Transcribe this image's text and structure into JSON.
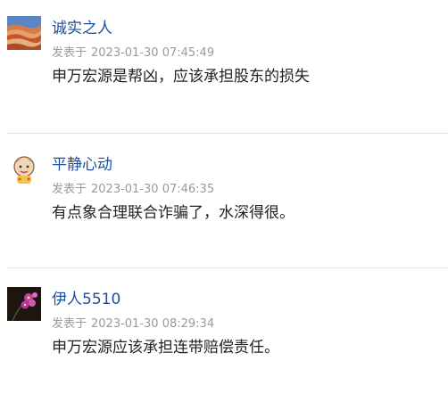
{
  "comments": [
    {
      "username": "诚实之人",
      "avatar_icon": "canyon-photo-avatar",
      "posted_label": "发表于",
      "timestamp": "2023-01-30 07:45:49",
      "text": "申万宏源是帮凶，应该承担股东的损失"
    },
    {
      "username": "平静心动",
      "avatar_icon": "cartoon-face-avatar",
      "posted_label": "发表于",
      "timestamp": "2023-01-30 07:46:35",
      "text": "有点象合理联合诈骗了，水深得很。"
    },
    {
      "username": "伊人5510",
      "avatar_icon": "orchid-photo-avatar",
      "posted_label": "发表于",
      "timestamp": "2023-01-30 08:29:34",
      "text": "申万宏源应该承担连带赔偿责任。"
    }
  ],
  "colors": {
    "username": "#1e4f9c",
    "meta": "#9a9a9a",
    "text": "#222222",
    "divider": "#e2e2e2"
  }
}
